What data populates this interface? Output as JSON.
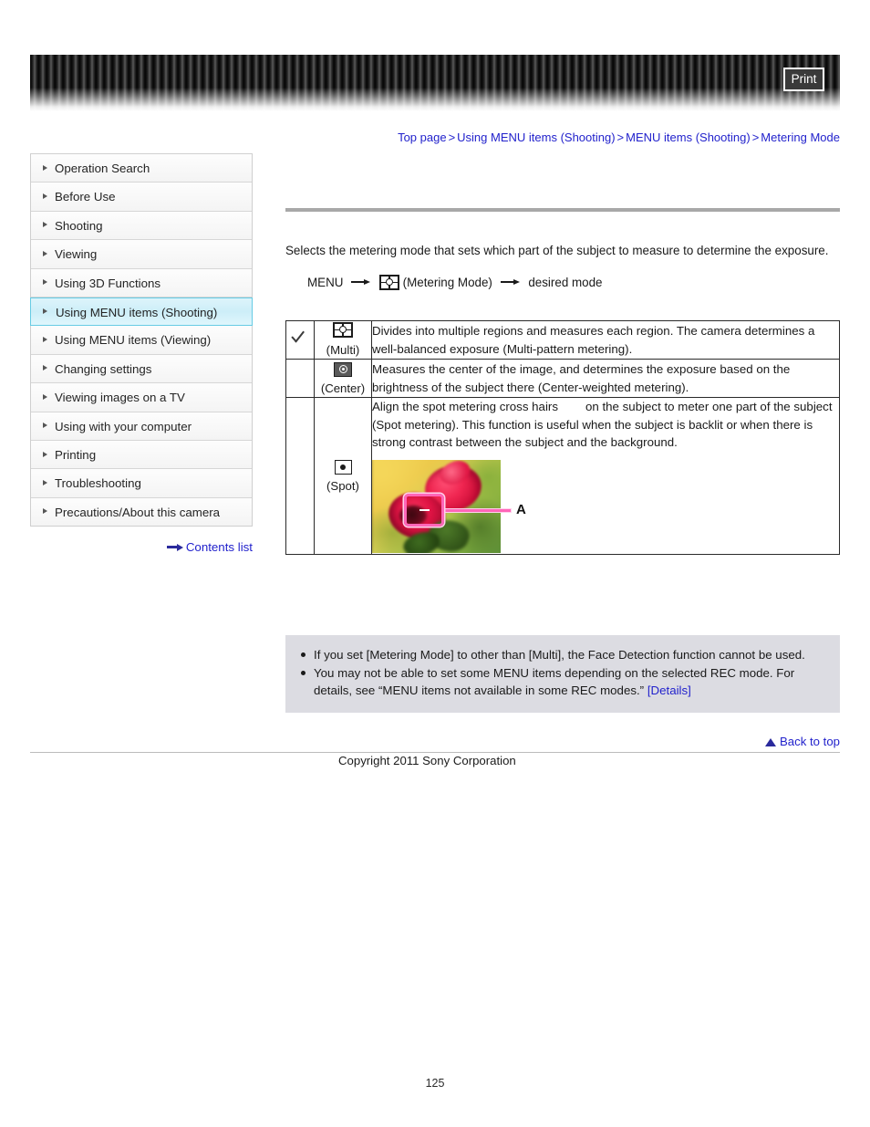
{
  "header": {
    "print_label": "Print"
  },
  "breadcrumb": {
    "items": [
      "Top page",
      "Using MENU items (Shooting)",
      "MENU items (Shooting)",
      "Metering Mode"
    ],
    "separator": ">"
  },
  "sidebar": {
    "items": [
      {
        "label": "Operation Search",
        "active": false
      },
      {
        "label": "Before Use",
        "active": false
      },
      {
        "label": "Shooting",
        "active": false
      },
      {
        "label": "Viewing",
        "active": false
      },
      {
        "label": "Using 3D Functions",
        "active": false
      },
      {
        "label": "Using MENU items (Shooting)",
        "active": true
      },
      {
        "label": "Using MENU items (Viewing)",
        "active": false
      },
      {
        "label": "Changing settings",
        "active": false
      },
      {
        "label": "Viewing images on a TV",
        "active": false
      },
      {
        "label": "Using with your computer",
        "active": false
      },
      {
        "label": "Printing",
        "active": false
      },
      {
        "label": "Troubleshooting",
        "active": false
      },
      {
        "label": "Precautions/About this camera",
        "active": false
      }
    ],
    "contents_list_label": "Contents list"
  },
  "main": {
    "intro": "Selects the metering mode that sets which part of the subject to measure to determine the exposure.",
    "menu_path": {
      "start": "MENU",
      "icon_label": "(Metering Mode)",
      "end": "desired mode"
    },
    "table": {
      "rows": [
        {
          "checked": true,
          "icon": "metering-multi-icon",
          "icon_label": "(Multi)",
          "description": "Divides into multiple regions and measures each region. The camera determines a well-balanced exposure (Multi-pattern metering)."
        },
        {
          "checked": false,
          "icon": "metering-center-icon",
          "icon_label": "(Center)",
          "description": "Measures the center of the image, and determines the exposure based on the brightness of the subject there (Center-weighted metering)."
        },
        {
          "checked": false,
          "icon": "metering-spot-icon",
          "icon_label": "(Spot)",
          "description_part1": "Align the spot metering cross hairs",
          "description_part2": "on the subject to meter one part of the subject (Spot metering). This function is useful when the subject is backlit or when there is strong contrast between the subject and the background.",
          "figure": {
            "alt": "rose-photo-with-spot-metering-frame",
            "callout_label": "A"
          }
        }
      ]
    },
    "notes": [
      "If you set [Metering Mode] to other than [Multi], the Face Detection function cannot be used.",
      "You may not be able to set some MENU items depending on the selected REC mode. For details, see “MENU items not available in some REC modes.” "
    ],
    "notes_link_label": "[Details]"
  },
  "footer": {
    "back_to_top_label": "Back to top",
    "copyright": "Copyright 2011 Sony Corporation",
    "page_number": "125"
  }
}
